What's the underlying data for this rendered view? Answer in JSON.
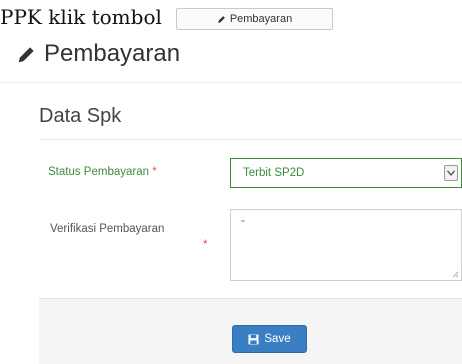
{
  "instruction": {
    "text": "PPK klik tombol",
    "button_label": "Pembayaran",
    "button_icon": "pencil-icon"
  },
  "page": {
    "title": "Pembayaran",
    "title_icon": "pencil-icon"
  },
  "form": {
    "section_title": "Data Spk",
    "status": {
      "label": "Status Pembayaran",
      "required_mark": "*",
      "value": "Terbit SP2D",
      "state_color": "#3c8d3c"
    },
    "verifikasi": {
      "label": "Verifikasi Pembayaran",
      "required_mark": "*",
      "value": "-"
    }
  },
  "footer": {
    "save_label": "Save",
    "save_icon": "floppy-disk-icon",
    "save_color": "#3a7fc4"
  }
}
